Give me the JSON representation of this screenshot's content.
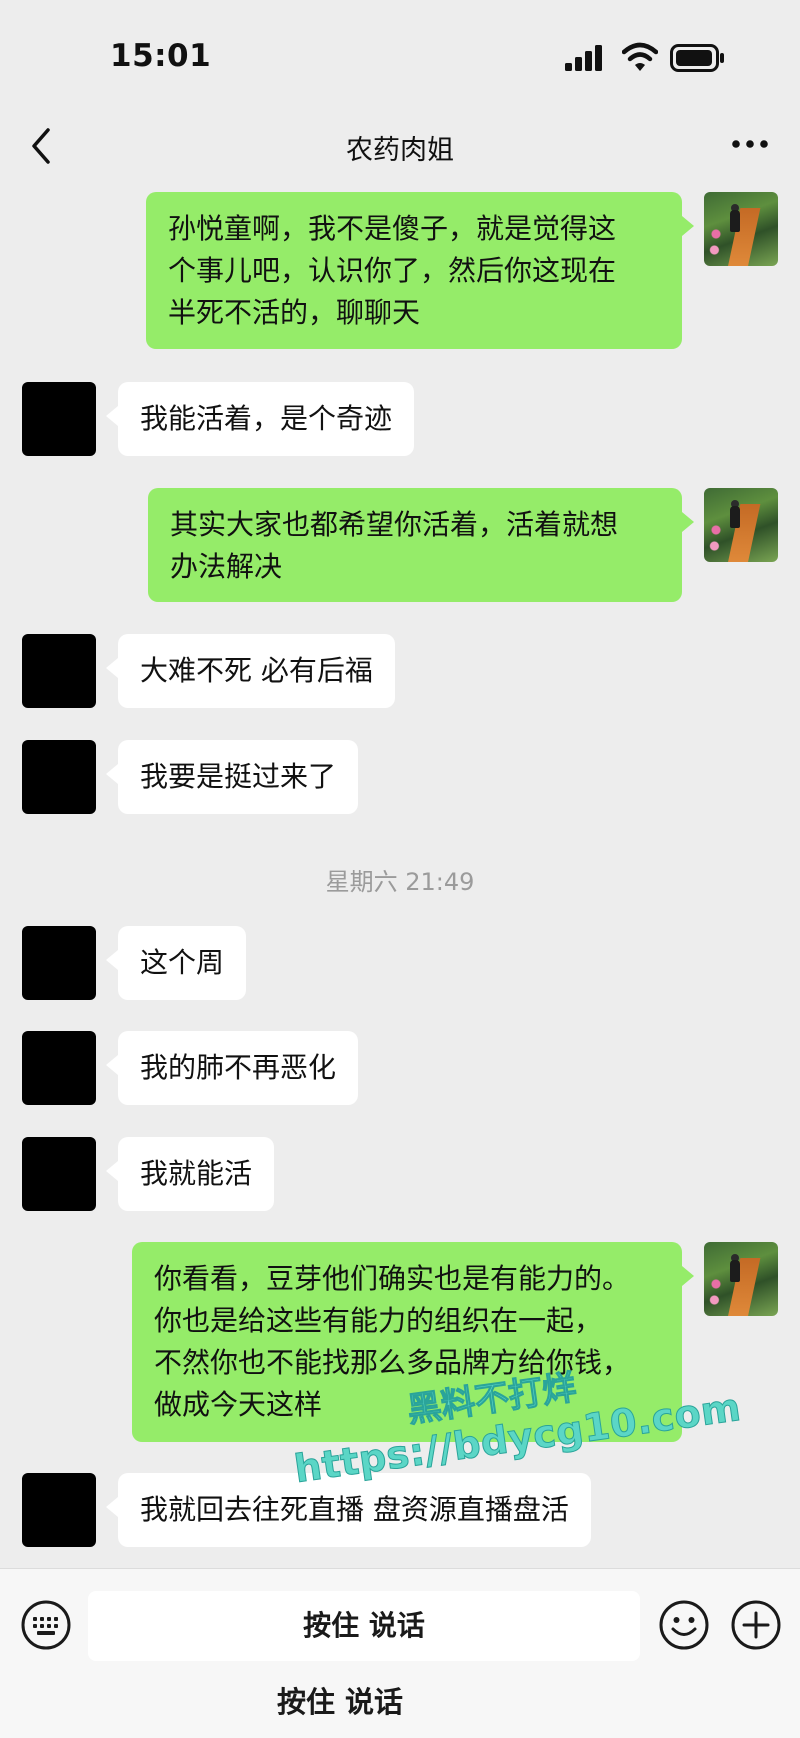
{
  "status_bar": {
    "time": "15:01"
  },
  "nav": {
    "title": "农药肉姐"
  },
  "messages": [
    {
      "side": "out",
      "text": "孙悦童啊，我不是傻子，就是觉得这\n个事儿吧，认识你了，然后你这现在\n半死不活的，聊聊天"
    },
    {
      "side": "in",
      "text": "我能活着，是个奇迹"
    },
    {
      "side": "out",
      "text": "其实大家也都希望你活着，活着就想\n办法解决"
    },
    {
      "side": "in",
      "text": "大难不死 必有后福"
    },
    {
      "side": "in",
      "text": "我要是挺过来了"
    },
    {
      "side": "in",
      "text": "这个周"
    },
    {
      "side": "in",
      "text": "我的肺不再恶化"
    },
    {
      "side": "in",
      "text": "我就能活"
    },
    {
      "side": "out",
      "text": "你看看，豆芽他们确实也是有能力的。\n你也是给这些有能力的组织在一起，\n不然你也不能找那么多品牌方给你钱，\n做成今天这样"
    },
    {
      "side": "in",
      "text": "我就回去往死直播 盘资源直播盘活"
    }
  ],
  "timestamp": "星期六 21:49",
  "watermark": {
    "line1": "黑料不打烊",
    "line2": "https://bdycg10.com"
  },
  "input_bar": {
    "voice_button_label": "按住 说话",
    "voice_hint": "按住 说话"
  }
}
